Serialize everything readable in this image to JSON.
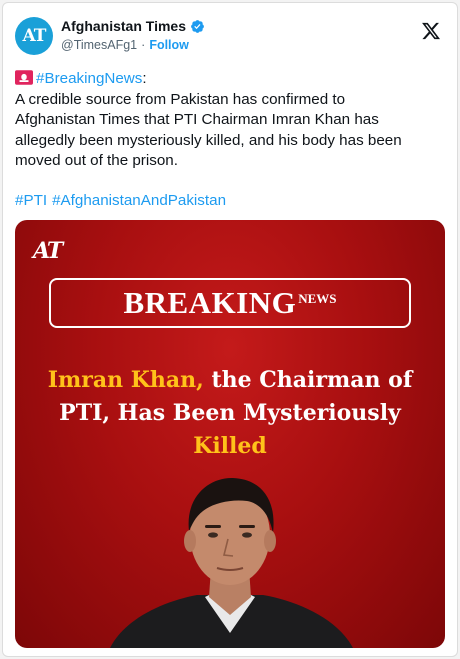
{
  "account": {
    "display_name": "Afghanistan Times",
    "handle": "@TimesAFg1",
    "separator": "·",
    "follow_label": "Follow",
    "avatar_text": "AT"
  },
  "tweet": {
    "breaking_tag": "#BreakingNews",
    "breaking_colon": ":",
    "lines": [
      "A credible source from Pakistan has confirmed to",
      "Afghanistan Times that PTI Chairman Imran Khan has",
      "allegedly been mysteriously killed, and his body has been",
      "moved out of the prison."
    ],
    "hashtags": [
      "#PTI",
      "#AfghanistanAndPakistan"
    ]
  },
  "media": {
    "logo_text": "AT",
    "breaking_word": "BREAKING",
    "news_word": "NEWS",
    "headline": {
      "part1": "Imran Khan,",
      "part2": " the Chairman of",
      "line2": "PTI, Has Been Mysteriously",
      "line3": "Killed"
    }
  },
  "colors": {
    "link_blue": "#1d9bf0",
    "media_red": "#a80f10",
    "headline_yellow": "#ffc21a",
    "text_dark": "#0f1419",
    "text_muted": "#536471"
  },
  "icons": {
    "verified": "verified-badge-icon",
    "platform": "x-logo-icon",
    "siren": "siren-icon"
  }
}
